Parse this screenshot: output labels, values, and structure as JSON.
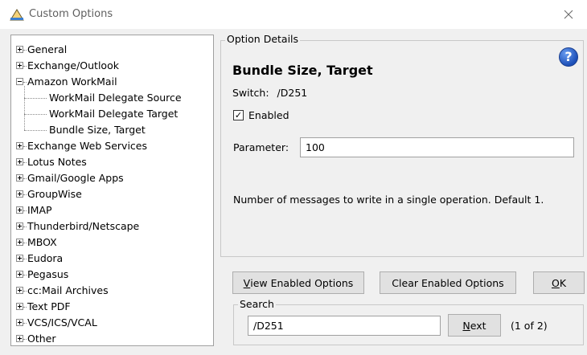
{
  "window": {
    "title": "Custom Options",
    "close_glyph": "✕",
    "icon": "custom-options-icon"
  },
  "tree": {
    "items": [
      {
        "label": "General",
        "level": 0,
        "expander": "plus"
      },
      {
        "label": "Exchange/Outlook",
        "level": 0,
        "expander": "plus"
      },
      {
        "label": "Amazon WorkMail",
        "level": 0,
        "expander": "minus"
      },
      {
        "label": "WorkMail Delegate Source",
        "level": 1
      },
      {
        "label": "WorkMail Delegate Target",
        "level": 1
      },
      {
        "label": "Bundle Size, Target",
        "level": 1,
        "selected": true
      },
      {
        "label": "Exchange Web Services",
        "level": 0,
        "expander": "plus"
      },
      {
        "label": "Lotus Notes",
        "level": 0,
        "expander": "plus"
      },
      {
        "label": "Gmail/Google Apps",
        "level": 0,
        "expander": "plus"
      },
      {
        "label": "GroupWise",
        "level": 0,
        "expander": "plus"
      },
      {
        "label": "IMAP",
        "level": 0,
        "expander": "plus"
      },
      {
        "label": "Thunderbird/Netscape",
        "level": 0,
        "expander": "plus"
      },
      {
        "label": "MBOX",
        "level": 0,
        "expander": "plus"
      },
      {
        "label": "Eudora",
        "level": 0,
        "expander": "plus"
      },
      {
        "label": "Pegasus",
        "level": 0,
        "expander": "plus"
      },
      {
        "label": "cc:Mail Archives",
        "level": 0,
        "expander": "plus"
      },
      {
        "label": "Text PDF",
        "level": 0,
        "expander": "plus"
      },
      {
        "label": "VCS/ICS/VCAL",
        "level": 0,
        "expander": "plus"
      },
      {
        "label": "Other",
        "level": 0,
        "expander": "plus"
      }
    ]
  },
  "details": {
    "legend": "Option Details",
    "title": "Bundle Size, Target",
    "switch_label": "Switch:",
    "switch_value": "/D251",
    "enabled_label": "Enabled",
    "enabled_checked": true,
    "parameter_label": "Parameter:",
    "parameter_value": "100",
    "description": "Number of messages to write in a single operation.  Default 1.",
    "help_glyph": "?"
  },
  "buttons": {
    "view_enabled_prefix": "V",
    "view_enabled_rest": "iew Enabled Options",
    "clear_enabled": "Clear Enabled Options",
    "ok_prefix": "O",
    "ok_rest": "K"
  },
  "search": {
    "legend": "Search",
    "value": "/D251",
    "next_prefix": "N",
    "next_rest": "ext",
    "match_count": "(1 of 2)"
  },
  "colors": {
    "help_icon": "#1c4fb8",
    "panel_bg": "#f0f0f0",
    "button_bg": "#e1e1e1"
  }
}
